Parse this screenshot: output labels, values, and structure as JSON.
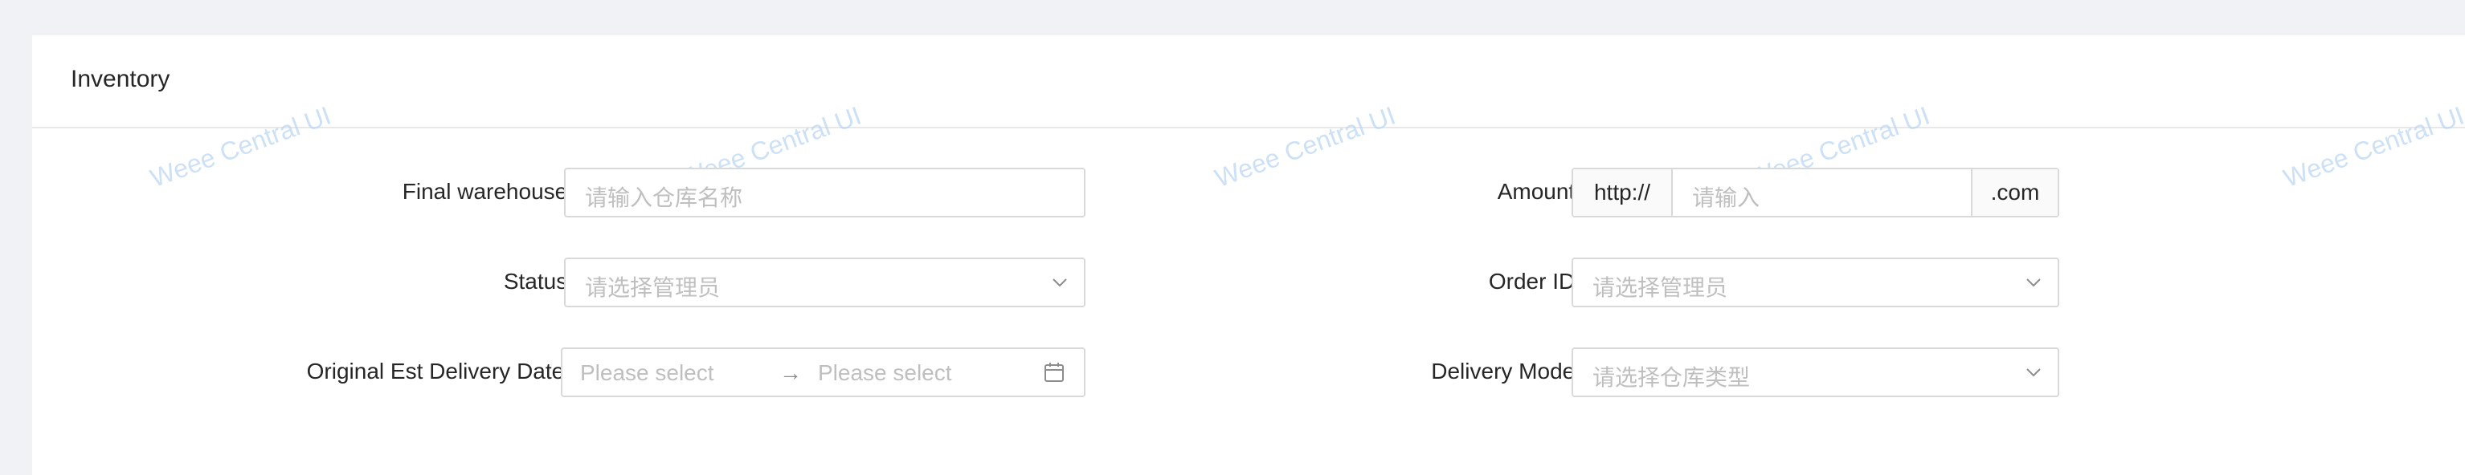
{
  "card": {
    "title": "Inventory"
  },
  "watermark": {
    "text": "Weee Central UI"
  },
  "form": {
    "final_warehouse": {
      "label": "Final warehouse",
      "placeholder": "请输入仓库名称"
    },
    "status": {
      "label": "Status",
      "placeholder": "请选择管理员",
      "icon": "chevron-down-icon"
    },
    "original_est_delivery_date": {
      "label": "Original Est Delivery Date",
      "start_placeholder": "Please select",
      "end_placeholder": "Please select",
      "separator": "→",
      "icon": "calendar-icon"
    },
    "amount": {
      "label": "Amount",
      "prefix": "http://",
      "placeholder": "请输入",
      "suffix": ".com"
    },
    "order_id": {
      "label": "Order ID",
      "placeholder": "请选择管理员",
      "icon": "chevron-down-icon"
    },
    "delivery_mode": {
      "label": "Delivery Mode",
      "placeholder": "请选择仓库类型",
      "icon": "chevron-down-icon"
    }
  },
  "colors": {
    "background": "#f0f2f5",
    "card": "#ffffff",
    "border": "#d9d9d9",
    "placeholder": "#bfbfbf",
    "label": "#262626",
    "watermark": "#bcd6f3"
  }
}
